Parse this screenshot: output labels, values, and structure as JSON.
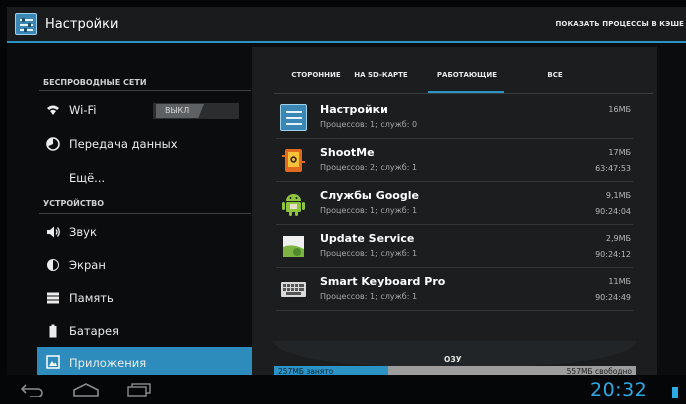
{
  "action_bar": {
    "title": "Настройки",
    "show_cached": "ПОКАЗАТЬ ПРОЦЕССЫ В КЭШЕ",
    "icon": "settings-app-icon"
  },
  "sidebar": {
    "categories": [
      {
        "label": "БЕСПРОВОДНЫЕ СЕТИ"
      },
      {
        "label": "УСТРОЙСТВО"
      }
    ],
    "items": [
      {
        "label": "Wi-Fi",
        "icon": "wifi-icon",
        "toggle": "ВЫКЛ"
      },
      {
        "label": "Передача данных",
        "icon": "data-usage-icon"
      },
      {
        "label": "Ещё..."
      },
      {
        "label": "Звук",
        "icon": "volume-icon"
      },
      {
        "label": "Экран",
        "icon": "display-icon"
      },
      {
        "label": "Память",
        "icon": "storage-icon"
      },
      {
        "label": "Батарея",
        "icon": "battery-icon"
      },
      {
        "label": "Приложения",
        "icon": "apps-icon",
        "selected": true
      }
    ]
  },
  "tabs": [
    {
      "label": "СТОРОННИЕ"
    },
    {
      "label": "НА SD-КАРТЕ"
    },
    {
      "label": "РАБОТАЮЩИЕ",
      "selected": true
    },
    {
      "label": "ВСЕ"
    }
  ],
  "processes": [
    {
      "name": "Настройки",
      "detail": "Процессов: 1; служб: 0",
      "size": "16МБ",
      "time": "",
      "icon": "settings-app-icon"
    },
    {
      "name": "ShootMe",
      "detail": "Процессов: 2; служб: 1",
      "size": "17МБ",
      "time": "63:47:53",
      "icon": "shootme-app-icon"
    },
    {
      "name": "Службы Google",
      "detail": "Процессов: 1; служб: 1",
      "size": "9,1МБ",
      "time": "90:24:04",
      "icon": "android-icon"
    },
    {
      "name": "Update Service",
      "detail": "Процессов: 1; служб: 1",
      "size": "2,9МБ",
      "time": "90:24:12",
      "icon": "update-service-icon"
    },
    {
      "name": "Smart Keyboard Pro",
      "detail": "Процессов: 1; служб: 1",
      "size": "11МБ",
      "time": "90:24:49",
      "icon": "keyboard-icon"
    }
  ],
  "ram": {
    "label": "ОЗУ",
    "used": "257МБ занято",
    "free": "557МБ свободно",
    "used_fraction": 0.316,
    "colors": {
      "used": "#2b93c6",
      "free": "#9d9d9d"
    }
  },
  "navbar": {
    "back": "back-icon",
    "home": "home-icon",
    "recents": "recent-apps-icon",
    "clock": "20:32"
  },
  "colors": {
    "accent": "#2b93c6",
    "clock": "#2ea9e6"
  }
}
